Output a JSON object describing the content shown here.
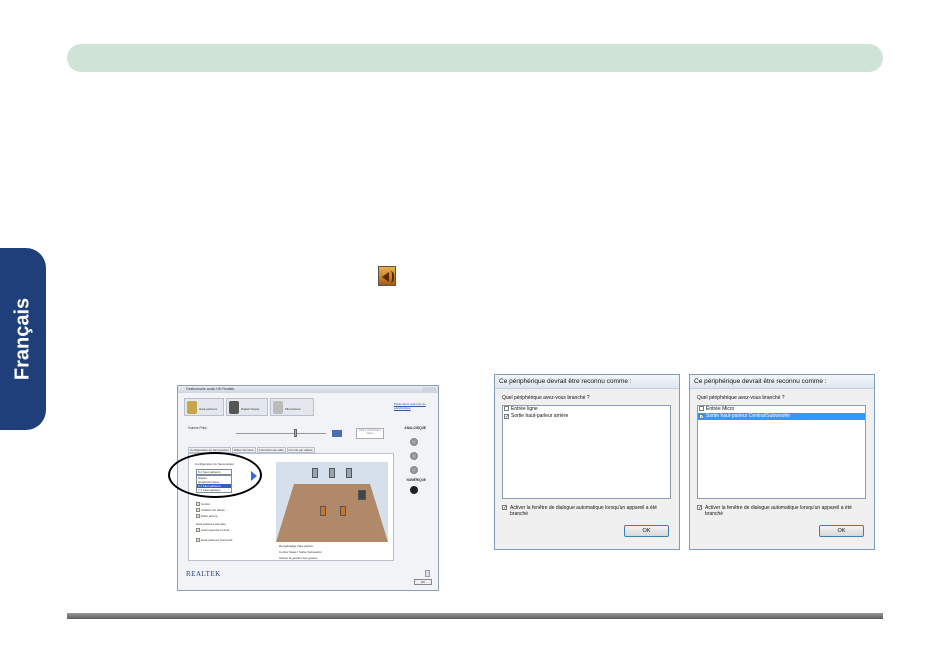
{
  "side_tab": {
    "label": "Français"
  },
  "realtek_window": {
    "title": "Gestionnaire audio HD Realtek",
    "tabs": [
      "Haut-parleurs",
      "Digital Output",
      "Microphone"
    ],
    "link": "Paramètres avancés du périphérique",
    "analog_label": "ANALOGIQUE",
    "digital_label": "NUMÉRIQUE",
    "volume_label": "Volume Princ.",
    "default_button": "Définir périphérique défaut",
    "subtabs": [
      "Configuration de haut-parleur",
      "Effets Sonores",
      "Correction de salle",
      "Format par défaut"
    ],
    "config_label": "Configuration du haut-parleur",
    "dropdown_value": "5.1 haut-parleurs",
    "dropdown_options": [
      "Stéréo",
      "Quadriphonique",
      "5.1 haut-parleurs",
      "7.1 haut-parleurs"
    ],
    "checks": [
      "Centre",
      "Caisson de basse",
      "Paire arrière",
      "Avant gauche et droit",
      "Haut-parleurs Surround"
    ],
    "group_label": "Haut-parleurs étendue",
    "right_options": [
      "Remplissage haut-parleur",
      "Centre Swap / Sortie Subwoofer",
      "Activer la gestion des graves"
    ],
    "brand": "REALTEK",
    "ok": "OK"
  },
  "dialogs": [
    {
      "title": "Ce périphérique devrait être reconnu comme :",
      "question": "Quel périphérique avez-vous branché ?",
      "items": [
        {
          "label": "Entrée ligne",
          "checked": false,
          "selected": false
        },
        {
          "label": "Sortie haut-parleur arrière",
          "checked": true,
          "selected": false
        }
      ],
      "auto_popup": "Activer la fenêtre de dialogue automatique lorsqu'un appareil a été branché",
      "ok": "OK"
    },
    {
      "title": "Ce périphérique devrait être reconnu comme :",
      "question": "Quel périphérique avez-vous branché ?",
      "items": [
        {
          "label": "Entrée Micro",
          "checked": false,
          "selected": false
        },
        {
          "label": "Sortie haut-parleur Central/Subwoofer",
          "checked": true,
          "selected": true
        }
      ],
      "auto_popup": "Activer la fenêtre de dialogue automatique lorsqu'un appareil a été branché",
      "ok": "OK"
    }
  ]
}
